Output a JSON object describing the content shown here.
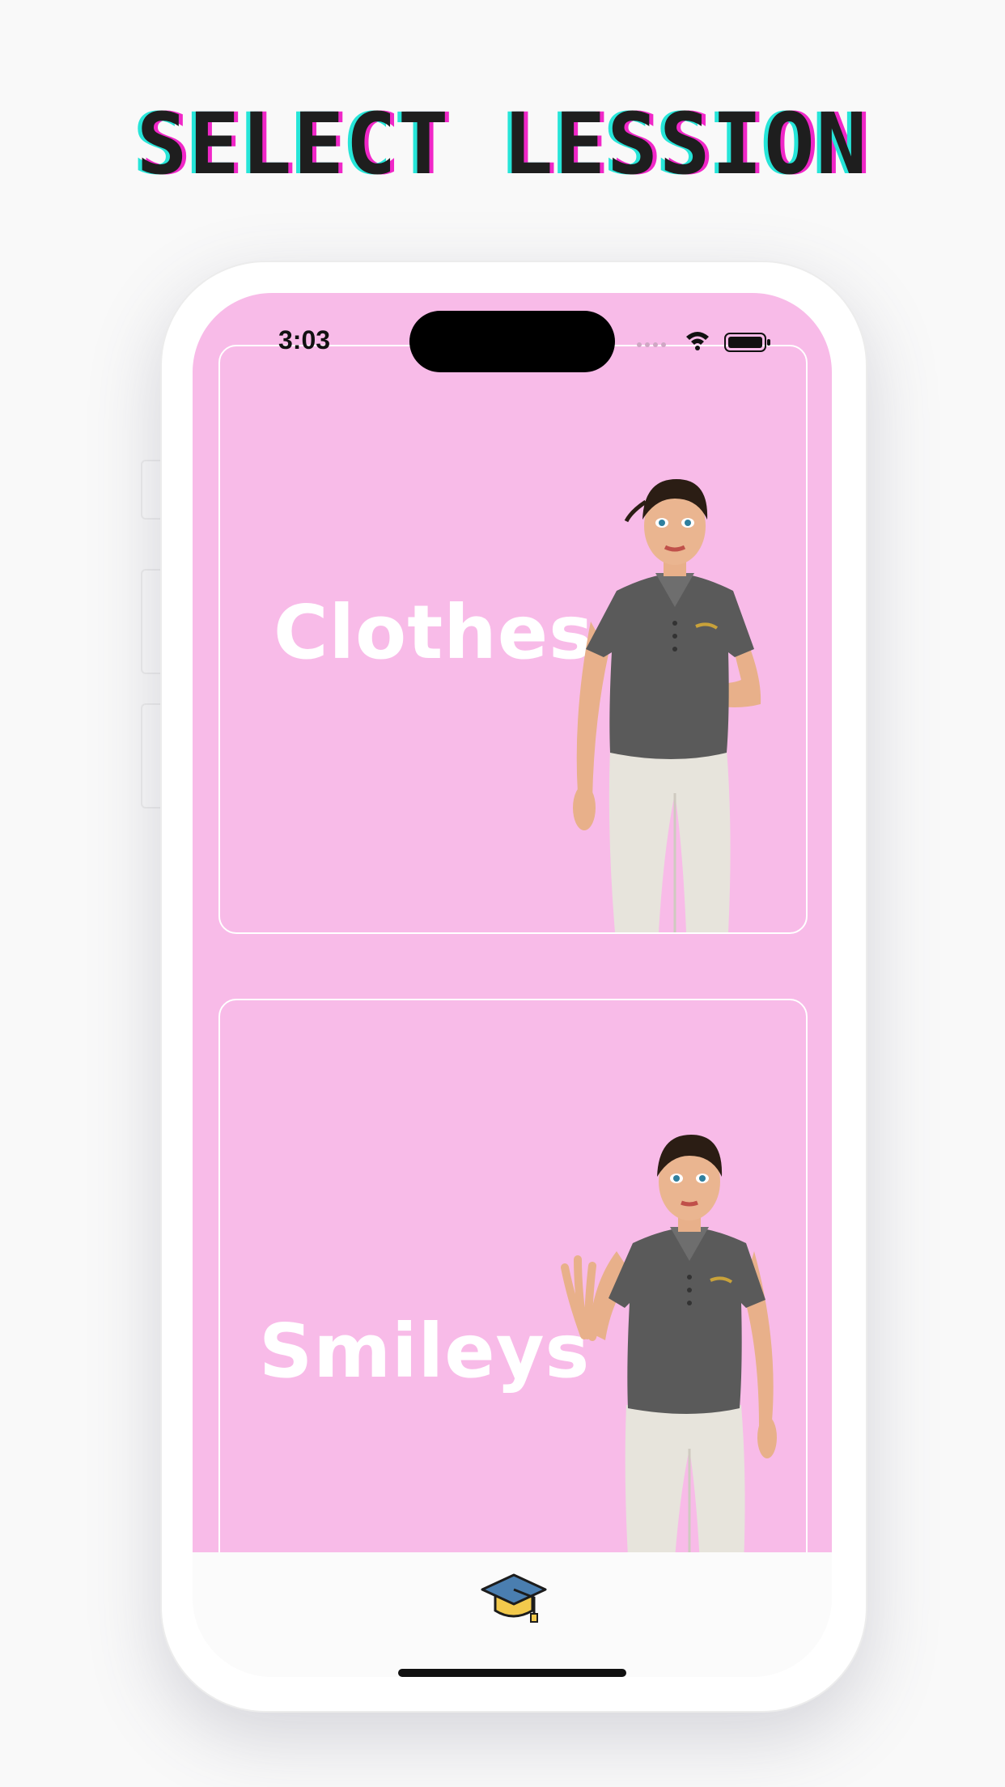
{
  "headline": "SELECT LESSION",
  "status_bar": {
    "time": "3:03"
  },
  "lessons": [
    {
      "title": "Clothes"
    },
    {
      "title": "Smileys"
    }
  ],
  "tab_bar": {
    "icon": "graduation-cap-icon"
  },
  "colors": {
    "screen_background": "#f8bbe8",
    "title_text": "#ffffff",
    "headline": "#1e1e1e"
  }
}
